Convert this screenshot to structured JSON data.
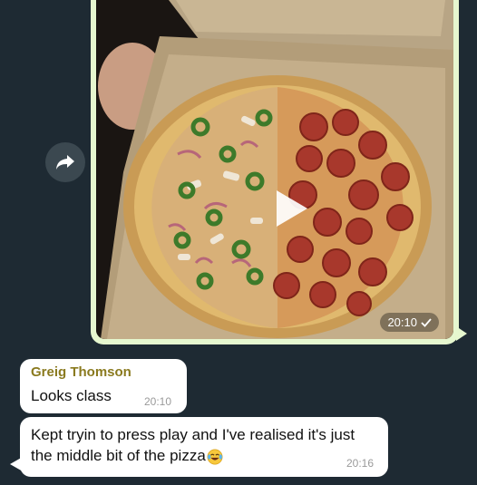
{
  "chat": {
    "messages": [
      {
        "type": "video",
        "time": "20:10",
        "status_icon": "single-check-icon",
        "play_icon": "play-icon"
      },
      {
        "type": "text",
        "sender": "Greig Thomson",
        "text": "Looks class",
        "time": "20:10"
      },
      {
        "type": "text",
        "text": "Kept tryin to press play and I've realised it's just the middle bit of the pizza",
        "emoji": "tears-of-joy-emoji",
        "time": "20:16"
      }
    ],
    "forward_icon": "forward-arrow-icon"
  },
  "colors": {
    "background": "#1e2a33",
    "outgoing_bubble": "#e6f7cf",
    "incoming_bubble": "#ffffff",
    "sender_name": "#8a7a1f"
  }
}
